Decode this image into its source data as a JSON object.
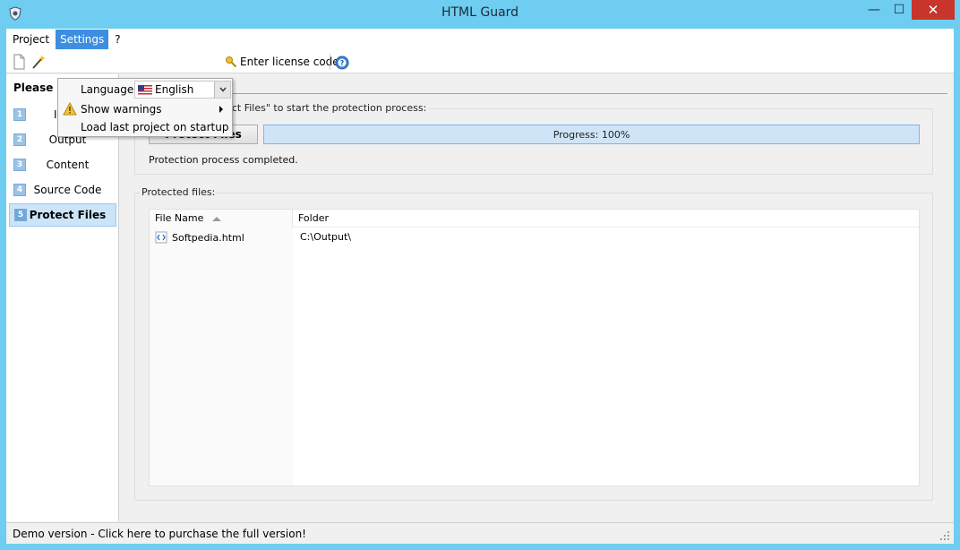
{
  "window": {
    "title": "HTML Guard",
    "minimize_glyph": "—",
    "maximize_glyph": "☐",
    "close_glyph": "✕"
  },
  "menubar": {
    "items": [
      {
        "label": "Project"
      },
      {
        "label": "Settings"
      },
      {
        "label": "?"
      }
    ]
  },
  "toolbar": {
    "license_label": "Enter license code",
    "icons": [
      "new-file-icon",
      "wizard-wand-icon",
      "key-icon",
      "help-icon"
    ]
  },
  "settings_menu": {
    "language_label": "Language:",
    "language_value": "English",
    "show_warnings_label": "Show warnings",
    "load_last_label": "Load last project on startup"
  },
  "leftnav": {
    "header": "Please",
    "items": [
      {
        "num": "1",
        "label": "Input"
      },
      {
        "num": "2",
        "label": "Output"
      },
      {
        "num": "3",
        "label": "Content"
      },
      {
        "num": "4",
        "label": "Source Code"
      },
      {
        "num": "5",
        "label": "Protect Files"
      }
    ]
  },
  "protect": {
    "group_label": "Please click \"Protect Files\" to start the protection process:",
    "button_label": "Protect Files",
    "progress_text": "Progress: 100%",
    "progress_value": 100,
    "status_text": "Protection process completed."
  },
  "files": {
    "group_label": "Protected files:",
    "columns": [
      "File Name",
      "Folder"
    ],
    "rows": [
      {
        "file": "Softpedia.html",
        "folder": "C:\\Output\\"
      }
    ]
  },
  "statusbar": {
    "text": "Demo version - Click here to purchase the full version!"
  },
  "colors": {
    "titlebar": "#6ecdf0",
    "menu_active": "#3d8ee0",
    "close_button": "#c7352b",
    "progress_fill": "#cfe4f7"
  }
}
